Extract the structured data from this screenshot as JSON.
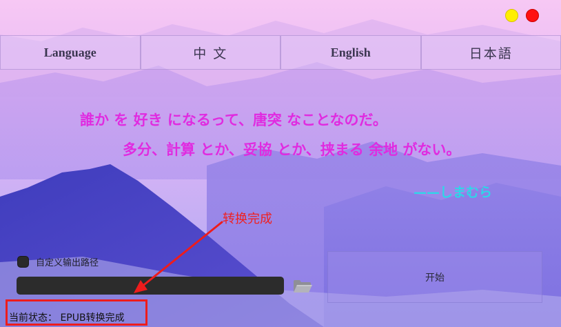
{
  "window_controls": {
    "minimize_color": "#ffee00",
    "close_color": "#ff1010"
  },
  "language_tabs": [
    {
      "label": "Language"
    },
    {
      "label": "中 文"
    },
    {
      "label": "English"
    },
    {
      "label": "日本語"
    }
  ],
  "quote": {
    "line1": "誰か を 好き になるって、唐突 なことなのだ。",
    "line2": "多分、計算 とか、妥協 とか、挟まる 余地 がない。",
    "signature": "——しまむら",
    "color": "#e02be0",
    "signature_color": "#2fd6e8"
  },
  "annotation": {
    "label": "转换完成",
    "color": "#ee1c1c"
  },
  "output": {
    "custom_path_label": "自定义输出路径",
    "custom_path_checked": false,
    "path_value": "",
    "folder_icon": "folder-open-icon"
  },
  "start_button": {
    "label": "开始"
  },
  "status": {
    "text": "当前状态：  EPUB转换完成"
  }
}
